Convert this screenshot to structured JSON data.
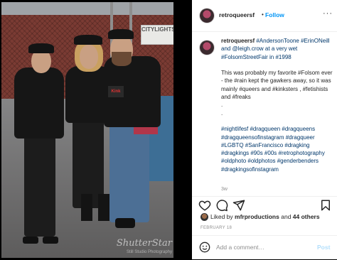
{
  "photo": {
    "sign_text": "CITYLIGHTS",
    "jacket_patch": "Kink",
    "watermark": "ShutterStar",
    "watermark_sub": "Still Studio Photography"
  },
  "post": {
    "username": "retroqueersf",
    "follow_label": "Follow",
    "more_glyph": "···",
    "caption": {
      "username": "retroqueersf",
      "line1": "#AndersonToone #ErinONeill and @leigh.crow at a very wet #FolsomStreetFair in #1998",
      "line2": "This was probably my favorite #Folsom ever - the #rain kept the gawkers away, so it was mainly #queers and #kinksters , #fetishists and #freaks",
      "dot1": ".",
      "dot2": ".",
      "hashtags": "#nightlifesf #dragqueen #dragqueens #dragqueensofinstagram #dragqueer #LGBTQ #SanFrancisco #dragking #dragkings #90s #00s #retrophotography #oldphoto #oldphotos #genderbenders #dragkingsofinstagram"
    },
    "time_ago": "3w",
    "likes": {
      "prefix": "Liked by",
      "user": "mfrproductions",
      "middle": "and",
      "others": "44 others"
    },
    "date": "FEBRUARY 18",
    "comment_placeholder": "Add a comment…",
    "post_label": "Post",
    "icons": [
      "heart-icon",
      "comment-icon",
      "share-icon",
      "bookmark-icon",
      "emoji-icon"
    ]
  },
  "colors": {
    "link": "#00376b",
    "follow": "#0095f6",
    "post_disabled": "#b2dffc",
    "muted": "#8e8e8e"
  }
}
